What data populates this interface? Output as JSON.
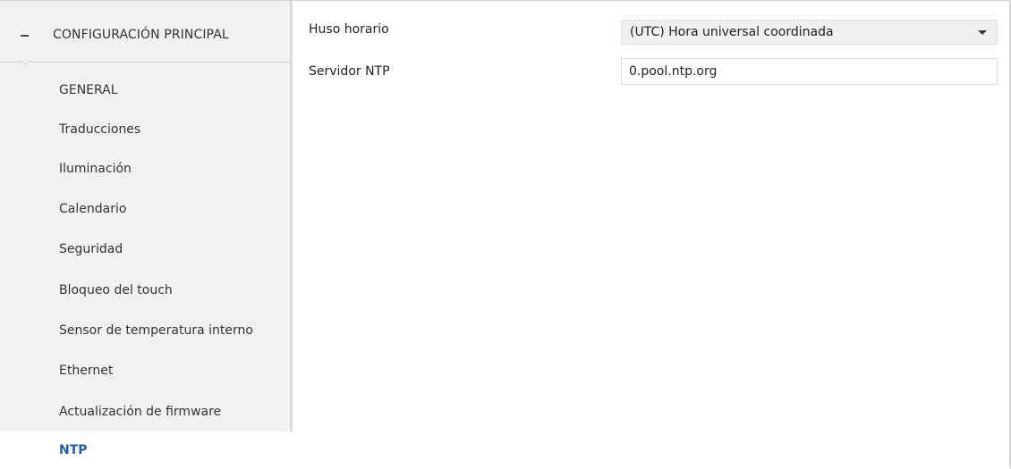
{
  "sidebar": {
    "section": {
      "title": "CONFIGURACIÓN PRINCIPAL",
      "collapse_icon": "minus-icon"
    },
    "items": [
      {
        "label": "GENERAL"
      },
      {
        "label": "Traducciones"
      },
      {
        "label": "Iluminación"
      },
      {
        "label": "Calendario"
      },
      {
        "label": "Seguridad"
      },
      {
        "label": "Bloqueo del touch"
      },
      {
        "label": "Sensor de temperatura interno"
      },
      {
        "label": "Ethernet"
      },
      {
        "label": "Actualización de firmware"
      },
      {
        "label": "NTP",
        "active": true
      }
    ]
  },
  "form": {
    "timezone": {
      "label": "Huso horario",
      "value": "(UTC) Hora universal coordinada"
    },
    "ntp_server": {
      "label": "Servidor NTP",
      "value": "0.pool.ntp.org"
    }
  },
  "colors": {
    "active_item": "#1f5f9f",
    "sidebar_bg": "#f1f1f1"
  }
}
